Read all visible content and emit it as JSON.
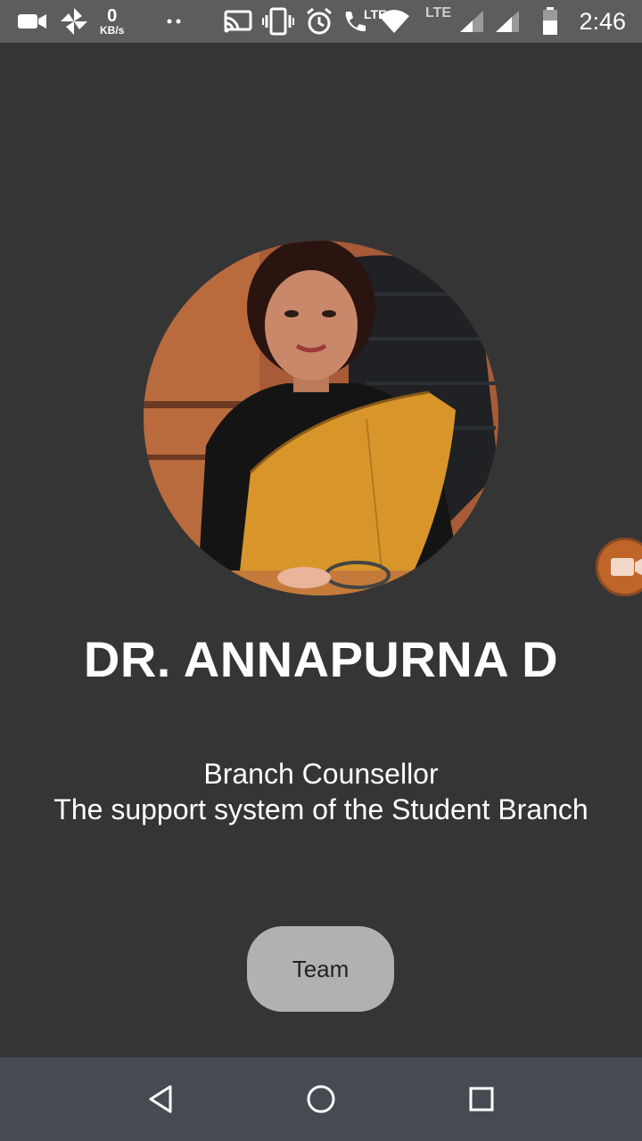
{
  "status_bar": {
    "net_speed_value": "0",
    "net_speed_unit": "KB/s",
    "lte_label_1": "LTE",
    "lte_label_2": "LTE",
    "time": "2:46"
  },
  "profile": {
    "name": "DR. ANNAPURNA D",
    "role": "Branch Counsellor",
    "description": "The support system of the Student Branch"
  },
  "actions": {
    "team_label": "Team"
  },
  "colors": {
    "background": "#353535",
    "status_bar": "#5d5d5d",
    "nav_bar": "#474b51",
    "team_button": "#b1b1b1",
    "float_button": "#c0652a",
    "saree": "#d8962a"
  },
  "icons": {
    "status_left": [
      "video-camera-icon",
      "pinwheel-icon",
      "more-dots-icon"
    ],
    "status_right": [
      "cast-icon",
      "vibrate-icon",
      "alarm-icon",
      "wifi-calling-icon",
      "wifi-icon",
      "signal-icon",
      "signal-icon",
      "battery-icon"
    ],
    "nav": [
      "back-icon",
      "home-icon",
      "recents-icon"
    ],
    "floating": "video-camera-icon"
  }
}
